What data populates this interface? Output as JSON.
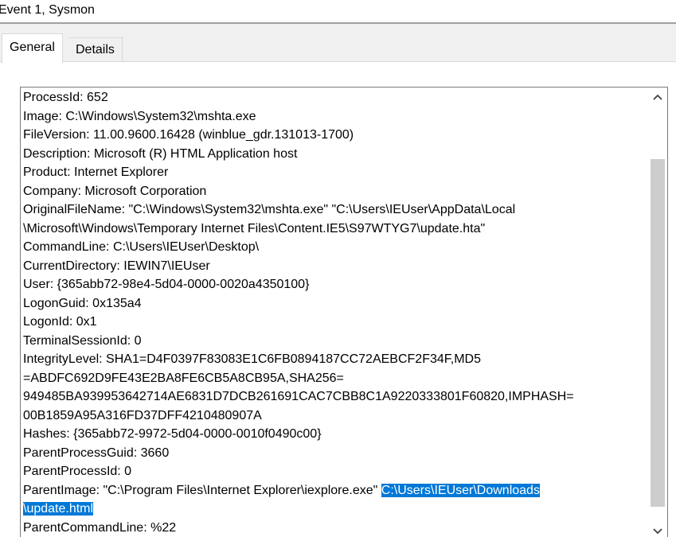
{
  "window": {
    "title": "Event 1, Sysmon"
  },
  "tabs": [
    {
      "label": "General",
      "active": true
    },
    {
      "label": "Details",
      "active": false
    }
  ],
  "event_text": {
    "lines": [
      "ProcessId: 652",
      "Image: C:\\Windows\\System32\\mshta.exe",
      "FileVersion: 11.00.9600.16428 (winblue_gdr.131013-1700)",
      "Description: Microsoft (R) HTML Application host",
      "Product: Internet Explorer",
      "Company: Microsoft Corporation",
      "OriginalFileName: \"C:\\Windows\\System32\\mshta.exe\" \"C:\\Users\\IEUser\\AppData\\Local",
      "\\Microsoft\\Windows\\Temporary Internet Files\\Content.IE5\\S97WTYG7\\update.hta\"",
      "CommandLine: C:\\Users\\IEUser\\Desktop\\",
      "CurrentDirectory: IEWIN7\\IEUser",
      "User: {365abb72-98e4-5d04-0000-0020a4350100}",
      "LogonGuid: 0x135a4",
      "LogonId: 0x1",
      "TerminalSessionId: 0",
      "IntegrityLevel: SHA1=D4F0397F83083E1C6FB0894187CC72AEBCF2F34F,MD5",
      "=ABDFC692D9FE43E2BA8FE6CB5A8CB95A,SHA256=",
      "949485BA939953642714AE6831D7DCB261691CAC7CBB8C1A9220333801F60820,IMPHASH=",
      "00B1859A95A316FD37DFF4210480907A",
      "Hashes: {365abb72-9972-5d04-0000-0010f0490c00}",
      "ParentProcessGuid: 3660",
      "ParentProcessId: 0"
    ],
    "parent_image_prefix": "ParentImage: \"C:\\Program Files\\Internet Explorer\\iexplore.exe\" ",
    "parent_image_selected_1": "C:\\Users\\IEUser\\Downloads",
    "parent_image_selected_2": "\\update.html",
    "last_line": "ParentCommandLine: %22"
  },
  "colors": {
    "selection_background": "#0078d7",
    "selection_text": "#ffffff",
    "scroll_thumb": "#cdcdcd"
  },
  "icons": {
    "scroll_up": "chevron-up-icon",
    "scroll_down": "chevron-down-icon"
  }
}
